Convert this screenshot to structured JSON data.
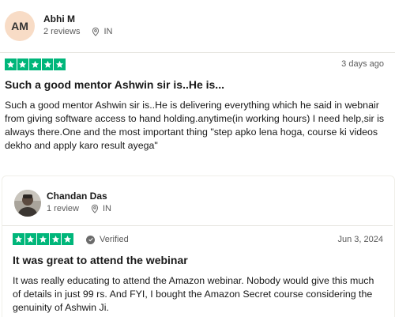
{
  "reviews": [
    {
      "avatar_initials": "AM",
      "name": "Abhi M",
      "review_count": "2 reviews",
      "country": "IN",
      "rating": 5,
      "date": "3 days ago",
      "title": "Such a good mentor Ashwin sir is..He is...",
      "body": "Such a good mentor Ashwin sir is..He is delivering everything which he said in webnair from giving software access to hand holding.anytime(in working hours) I need help,sir is always there.One and the most important thing \"step apko lena hoga, course ki videos dekho and apply karo result ayega\""
    },
    {
      "name": "Chandan Das",
      "review_count": "1 review",
      "country": "IN",
      "rating": 5,
      "verified_label": "Verified",
      "date": "Jun 3, 2024",
      "title": "It was great to attend the webinar",
      "body": "It was really educating to attend the Amazon webinar. Nobody would give this much of details in just 99 rs. And FYI, I bought the Amazon Secret course considering the genuinity of Ashwin Ji."
    }
  ],
  "colors": {
    "star_green": "#00b67a",
    "avatar_bg": "#f8dcc6",
    "muted_text": "#5a5a5a"
  }
}
